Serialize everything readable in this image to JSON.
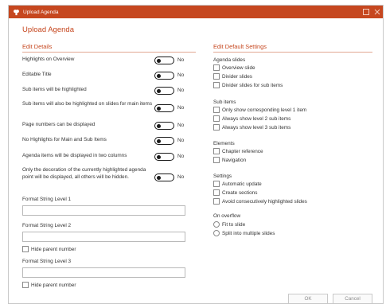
{
  "window": {
    "title": "Upload Agenda",
    "title_bar_color": "#c6471f",
    "icons": [
      "app-icon",
      "maximize-icon",
      "close-icon"
    ]
  },
  "heading": "Upload Agenda",
  "accent_color": "#c6471f",
  "left_section": {
    "title": "Edit Details",
    "toggles": [
      {
        "label": "Highlights on Overview",
        "state": "No"
      },
      {
        "label": "Editable Title",
        "state": "No"
      },
      {
        "label": "Sub items will be highlighted",
        "state": "No"
      },
      {
        "label": "Sub items will also be highlighted on slides for main items",
        "state": "No"
      },
      {
        "label": "Page numbers can be displayed",
        "state": "No"
      },
      {
        "label": "No Highlights for Main and Sub Items",
        "state": "No"
      },
      {
        "label": "Agenda items will be displayed in two columns",
        "state": "No"
      },
      {
        "label": "Only the decoration of the currently highlighted agenda point will be displayed, all others will be hidden.",
        "state": "No"
      }
    ],
    "format_level_1": {
      "label": "Format String Level 1",
      "value": ""
    },
    "format_level_2": {
      "label": "Format String Level 2",
      "value": "",
      "hide_parent_label": "Hide parent number"
    },
    "format_level_3": {
      "label": "Format String Level 3",
      "value": "",
      "hide_parent_label": "Hide parent number"
    }
  },
  "right_section": {
    "title": "Edit Default Settings",
    "agenda_slides": {
      "title": "Agenda slides",
      "options": [
        "Overview slide",
        "Divider slides",
        "Divider slides for sub items"
      ]
    },
    "sub_items": {
      "title": "Sub items",
      "options": [
        "Only show corresponding level 1 item",
        "Always show level 2 sub items",
        "Always show level 3 sub items"
      ]
    },
    "elements": {
      "title": "Elements",
      "options": [
        "Chapter reference",
        "Navigation"
      ]
    },
    "settings": {
      "title": "Settings",
      "options": [
        "Automatic update",
        "Create sections",
        "Avoid consecutively highlighted slides"
      ]
    },
    "on_overflow": {
      "title": "On overflow",
      "options": [
        "Fit to slide",
        "Split into multiple slides"
      ]
    }
  },
  "buttons": {
    "ok": "OK",
    "cancel": "Cancel"
  }
}
